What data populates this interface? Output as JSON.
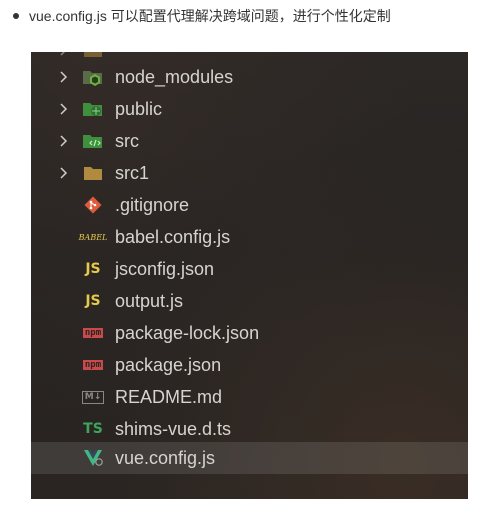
{
  "caption": {
    "text": "vue.config.js 可以配置代理解决跨域问题，进行个性化定制"
  },
  "explorer": {
    "items": [
      {
        "label": "node_modules",
        "icon": "folder-node-icon",
        "type": "folder"
      },
      {
        "label": "public",
        "icon": "folder-public-icon",
        "type": "folder"
      },
      {
        "label": "src",
        "icon": "folder-src-icon",
        "type": "folder"
      },
      {
        "label": "src1",
        "icon": "folder-icon",
        "type": "folder"
      },
      {
        "label": ".gitignore",
        "icon": "git-icon",
        "type": "file"
      },
      {
        "label": "babel.config.js",
        "icon": "babel-icon",
        "type": "file",
        "icon_text": "BABEL"
      },
      {
        "label": "jsconfig.json",
        "icon": "js-config-icon",
        "type": "file",
        "icon_text": "JS"
      },
      {
        "label": "output.js",
        "icon": "js-icon",
        "type": "file",
        "icon_text": "JS"
      },
      {
        "label": "package-lock.json",
        "icon": "npm-icon",
        "type": "file",
        "icon_text": "npm"
      },
      {
        "label": "package.json",
        "icon": "npm-icon",
        "type": "file",
        "icon_text": "npm"
      },
      {
        "label": "README.md",
        "icon": "markdown-icon",
        "type": "file",
        "icon_text": "M↓"
      },
      {
        "label": "shims-vue.d.ts",
        "icon": "typescript-icon",
        "type": "file",
        "icon_text": "TS"
      },
      {
        "label": "vue.config.js",
        "icon": "vue-icon",
        "type": "file",
        "selected": true
      }
    ]
  },
  "colors": {
    "folder": "#b08a3e",
    "node_green": "#6cb33e",
    "js_yellow": "#e6c84a",
    "npm_red": "#c94a4a",
    "ts_green": "#3da55a",
    "vue_green": "#41b883",
    "git_red": "#e05b3a"
  }
}
